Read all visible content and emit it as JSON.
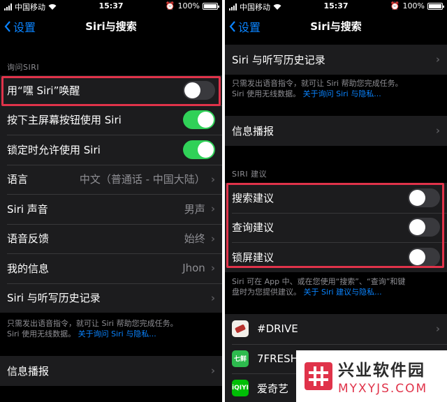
{
  "status_bar": {
    "carrier": "中国移动",
    "time": "15:37",
    "battery": "100%",
    "battery_level": 1.0
  },
  "nav": {
    "back_label": "设置",
    "title": "Siri与搜索"
  },
  "left": {
    "section_header": "询问SIRI",
    "rows": [
      {
        "label": "用“嘿 Siri”唤醒",
        "control": "toggle",
        "on": false
      },
      {
        "label": "按下主屏幕按钮使用 Siri",
        "control": "toggle",
        "on": true
      },
      {
        "label": "锁定时允许使用 Siri",
        "control": "toggle",
        "on": true
      },
      {
        "label": "语言",
        "value": "中文（普通话 - 中国大陆）",
        "control": "chevron"
      },
      {
        "label": "Siri 声音",
        "value": "男声",
        "control": "chevron"
      },
      {
        "label": "语音反馈",
        "value": "始终",
        "control": "chevron"
      },
      {
        "label": "我的信息",
        "value": "Jhon",
        "control": "chevron"
      },
      {
        "label": "Siri 与听写历史记录",
        "control": "chevron"
      }
    ],
    "footer_line1": "只需发出语音指令，就可让 Siri 帮助您完成任务。",
    "footer_line2": "Siri 使用无线数据。",
    "footer_link": "关于询问 Siri 与隐私...",
    "announce_label": "信息播报"
  },
  "right": {
    "history_label": "Siri 与听写历史记录",
    "footer_line1": "只需发出语音指令，就可让 Siri 帮助您完成任务。",
    "footer_line2": "Siri 使用无线数据。",
    "footer_link": "关于询问 Siri 与隐私...",
    "announce_label": "信息播报",
    "section_header": "SIRI 建议",
    "suggestions": [
      {
        "label": "搜索建议",
        "on": false
      },
      {
        "label": "查询建议",
        "on": false
      },
      {
        "label": "锁屏建议",
        "on": false
      }
    ],
    "suggest_footer_line1": "Siri 可在 App 中、或在您使用“搜索”、“查询”和键",
    "suggest_footer_line2": "盘时为您提供建议。",
    "suggest_footer_link": "关于 Siri 建议与隐私...",
    "apps": [
      {
        "name": "#DRIVE",
        "icon": "drive-app-icon",
        "color": "#f2efe9"
      },
      {
        "name": "7FRESH",
        "icon": "7fresh-app-icon",
        "color": "#2dbb4e",
        "icon_text": "七鲜"
      },
      {
        "name": "爱奇艺",
        "icon": "iqiyi-app-icon",
        "color": "#00be06",
        "icon_text": "iQIYI"
      }
    ]
  },
  "watermark": {
    "title": "兴业软件园",
    "subtitle": "MYXYJS.COM"
  },
  "colors": {
    "accent": "#0a84ff",
    "toggle_on": "#30d158",
    "highlight": "#e0334a"
  }
}
